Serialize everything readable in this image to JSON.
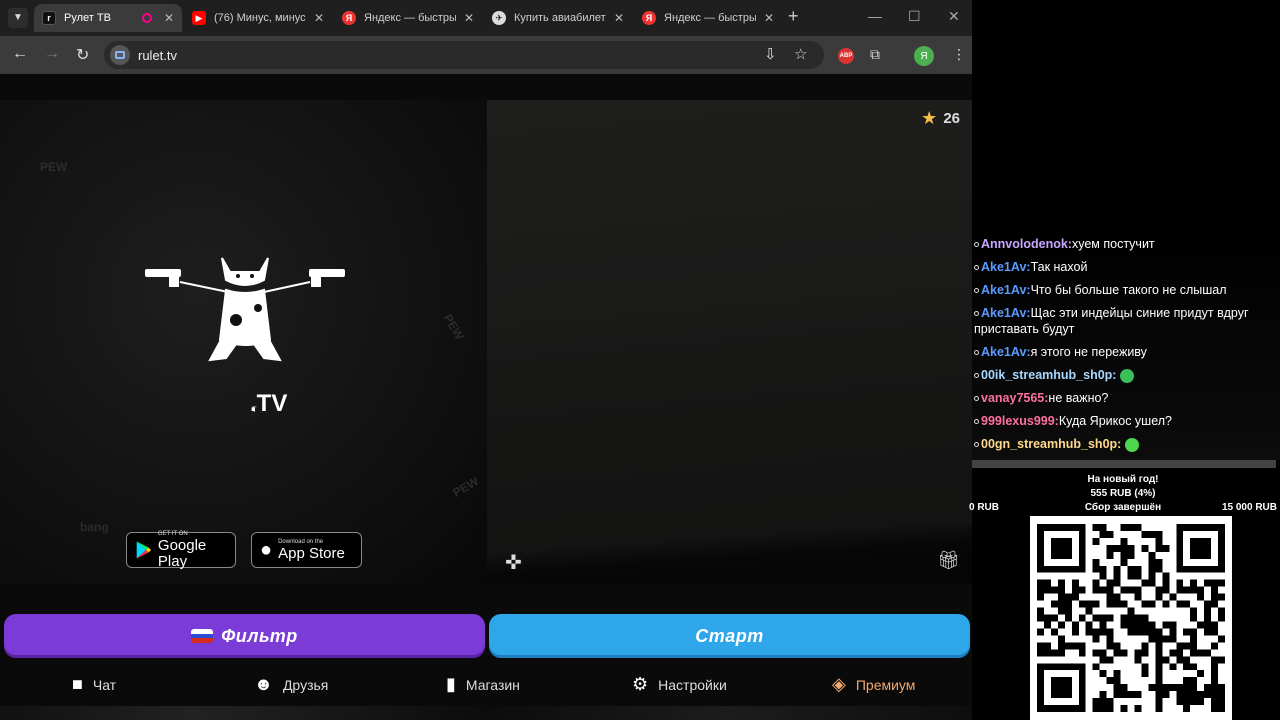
{
  "browser": {
    "tabs": [
      {
        "label": "Рулет ТВ",
        "active": true,
        "icon": "rulet-favicon"
      },
      {
        "label": "(76) Минус, минус",
        "active": false,
        "icon": "youtube-icon"
      },
      {
        "label": "Яндекс — быстрый",
        "active": false,
        "icon": "yandex-icon"
      },
      {
        "label": "Купить авиабилет",
        "active": false,
        "icon": "plane-favicon"
      },
      {
        "label": "Яндекс — быстрый",
        "active": false,
        "icon": "yandex-icon"
      }
    ],
    "url": "rulet.tv",
    "extension_abp": "ABP",
    "profile_letter": "Я"
  },
  "app": {
    "logo_text": ".TV",
    "logo_prefix": "т",
    "doodle_words": [
      "PEW",
      "PEW",
      "PEW",
      "bang"
    ],
    "google_play": {
      "small": "GET IT ON",
      "big": "Google Play"
    },
    "app_store": {
      "small": "Download on the",
      "big": "App Store"
    },
    "rating": "26",
    "filter_label": "Фильтр",
    "start_label": "Старт",
    "nav": [
      "Чат",
      "Друзья",
      "Магазин",
      "Настройки",
      "Премиум"
    ],
    "colors": {
      "filter": "#7a3bd6",
      "start": "#2fa5ea",
      "premium": "#f0a970"
    }
  },
  "chat": {
    "messages": [
      {
        "nick": "Annvolodenok:",
        "text": "хуем постучит",
        "color": "#c7a6ff"
      },
      {
        "nick": "Ake1Av:",
        "text": "Так нахой",
        "color": "#5b9bff"
      },
      {
        "nick": "Ake1Av:",
        "text": "Что бы больше такого не слышал",
        "color": "#5b9bff"
      },
      {
        "nick": "Ake1Av:",
        "text": "Щас эти индейцы синие придут вдруг приставать будут",
        "color": "#5b9bff"
      },
      {
        "nick": "Ake1Av:",
        "text": "я этого не переживу",
        "color": "#5b9bff"
      },
      {
        "nick": "00ik_streamhub_sh0p:",
        "text": "",
        "color": "#a8d8ff"
      },
      {
        "nick": "vanay7565:",
        "text": "не важно?",
        "color": "#ff6fa0"
      },
      {
        "nick": "999lexus999:",
        "text": "Куда Ярикос ушел?",
        "color": "#ff6fa0"
      },
      {
        "nick": "00gn_streamhub_sh0p:",
        "text": "",
        "color": "#ffd98a"
      }
    ]
  },
  "donation": {
    "title": "На новый год!",
    "amount": "555 RUB (4%)",
    "min": "0 RUB",
    "status": "Сбор завершён",
    "max": "15 000 RUB",
    "progress": 0.04
  }
}
